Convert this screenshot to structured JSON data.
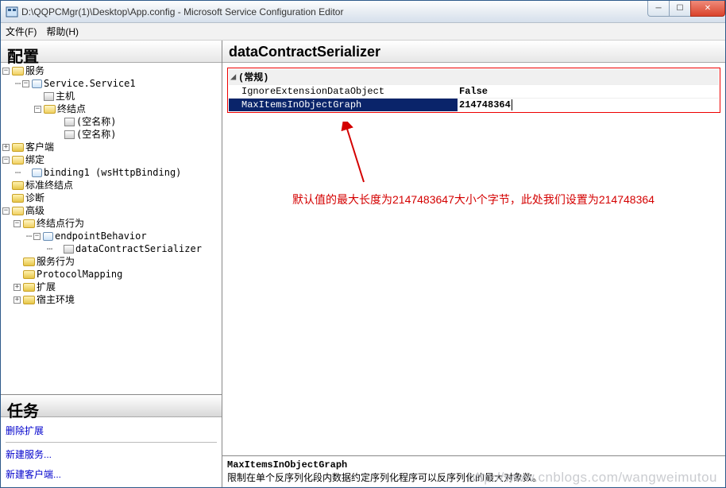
{
  "window": {
    "title": "D:\\QQPCMgr(1)\\Desktop\\App.config - Microsoft Service Configuration Editor"
  },
  "menu": {
    "file": "文件(F)",
    "help": "帮助(H)"
  },
  "leftPanel": {
    "title": "配置"
  },
  "tree": {
    "services": "服务",
    "service1": "Service.Service1",
    "host": "主机",
    "endpoints": "终结点",
    "empty1": "(空名称)",
    "empty2": "(空名称)",
    "client": "客户端",
    "bindings": "绑定",
    "binding1": "binding1 (wsHttpBinding)",
    "stdendpoints": "标准终结点",
    "diagnostics": "诊断",
    "advanced": "高级",
    "epbehavior": "终结点行为",
    "epbehaviornode": "endpointBehavior",
    "dcs": "dataContractSerializer",
    "svcbehavior": "服务行为",
    "protocolmapping": "ProtocolMapping",
    "extensions": "扩展",
    "hostenv": "宿主环境"
  },
  "tasks": {
    "title": "任务",
    "delete": "删除扩展",
    "newservice": "新建服务...",
    "newclient": "新建客户端..."
  },
  "rightPanel": {
    "title": "dataContractSerializer"
  },
  "props": {
    "category": "(常规)",
    "row1_name": "IgnoreExtensionDataObject",
    "row1_val": "False",
    "row2_name": "MaxItemsInObjectGraph",
    "row2_val": "214748364"
  },
  "annotation": "默认值的最大长度为2147483647大小个字节，此处我们设置为214748364",
  "desc": {
    "name": "MaxItemsInObjectGraph",
    "text": "限制在单个反序列化段内数据约定序列化程序可以反序列化的最大对象数。"
  },
  "watermark": "http://www.cnblogs.com/wangweimutou"
}
